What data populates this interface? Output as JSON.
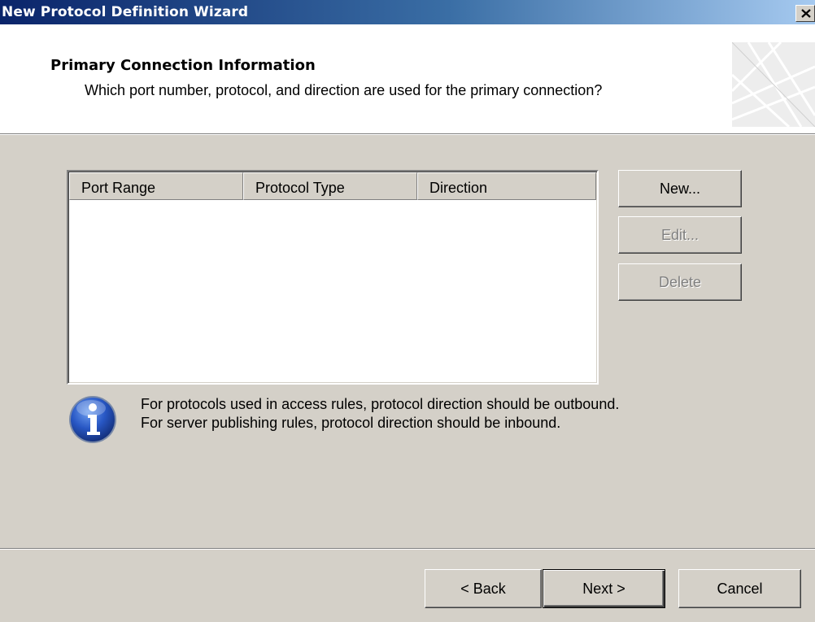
{
  "window": {
    "title": "New Protocol Definition Wizard",
    "close_icon": "close-icon"
  },
  "header": {
    "title": "Primary Connection Information",
    "subtitle": "Which port number, protocol, and direction are used for the primary connection?"
  },
  "protocol_list": {
    "columns": [
      "Port Range",
      "Protocol Type",
      "Direction"
    ],
    "rows": []
  },
  "side_buttons": {
    "new_label": "New...",
    "edit_label": "Edit...",
    "delete_label": "Delete"
  },
  "info": {
    "icon": "info-icon",
    "line1": "For protocols used in access rules, protocol direction should be outbound.",
    "line2": "For server publishing rules, protocol direction should be inbound."
  },
  "footer": {
    "back_label": "< Back",
    "next_label": "Next >",
    "cancel_label": "Cancel"
  }
}
